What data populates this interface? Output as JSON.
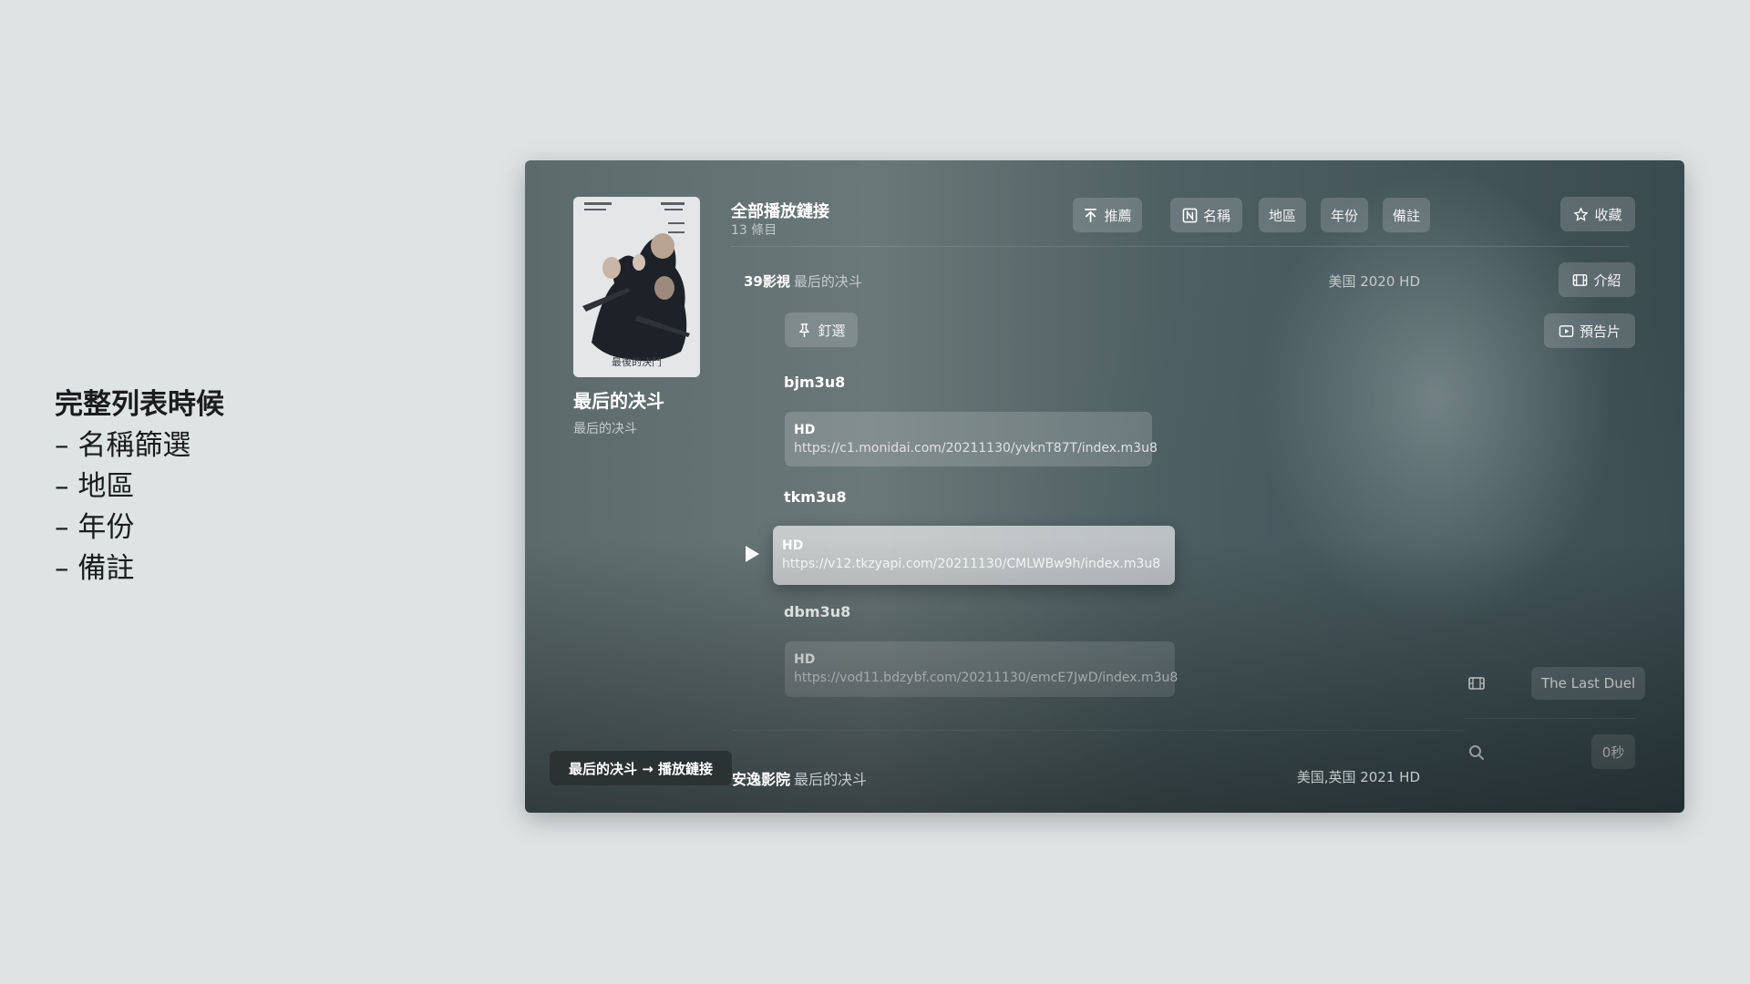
{
  "notes": {
    "title": "完整列表時候",
    "items": [
      "– 名稱篩選",
      "– 地區",
      "– 年份",
      "– 備註"
    ]
  },
  "movie": {
    "title": "最后的决斗",
    "subtitle": "最后的决斗",
    "poster_caption": "最後的決鬥"
  },
  "list": {
    "title": "全部播放鏈接",
    "count": "13 條目"
  },
  "filters": {
    "recommend": "推薦",
    "name": "名稱",
    "region": "地區",
    "year": "年份",
    "note": "備註"
  },
  "actions": {
    "favorite": "收藏",
    "intro": "介紹",
    "trailer": "預告片"
  },
  "source": {
    "name": "39影視",
    "title": "最后的决斗",
    "meta": "美国 2020 HD",
    "pin_label": "釘選"
  },
  "groups": [
    {
      "label": "bjm3u8",
      "quality": "HD",
      "url": "https://c1.monidai.com/20211130/yvknT87T/index.m3u8"
    },
    {
      "label": "tkm3u8",
      "quality": "HD",
      "url": "https://v12.tkzyapi.com/20211130/CMLWBw9h/index.m3u8"
    },
    {
      "label": "dbm3u8",
      "quality": "HD",
      "url": "https://vod11.bdzybf.com/20211130/emcE7JwD/index.m3u8"
    }
  ],
  "side": {
    "original_title": "The Last Duel",
    "time": "0秒"
  },
  "bottom": {
    "source_name": "安逸影院",
    "title": "最后的决斗",
    "meta": "美国,英国 2021 HD"
  },
  "toast": "最后的决斗 → 播放鏈接"
}
